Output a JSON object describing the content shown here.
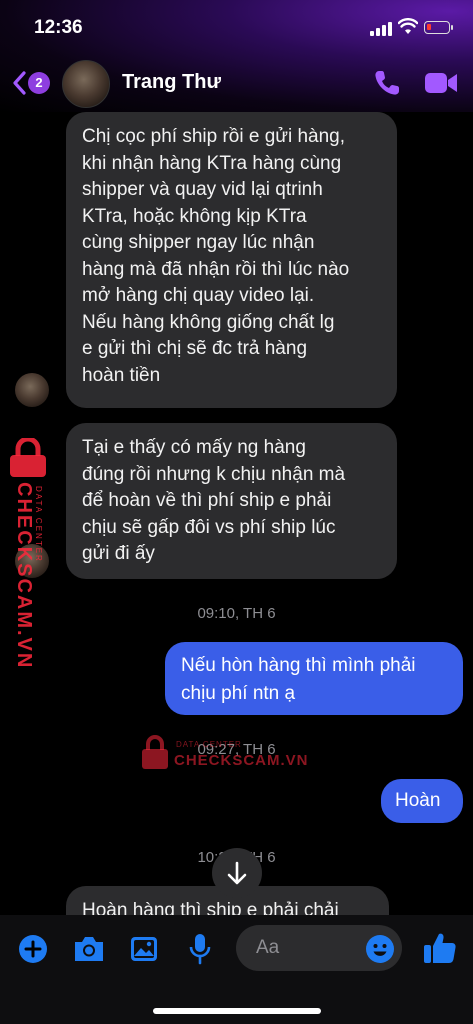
{
  "status_bar": {
    "time": "12:36"
  },
  "header": {
    "back_badge": "2",
    "contact_name": "Trang Thư"
  },
  "messages": {
    "m1": "Chị cọc phí ship rồi e gửi hàng,\nkhi nhận hàng KTra hàng cùng\nshipper và quay vid lại qtrinh\nKTra, hoặc không kịp KTra\ncùng shipper ngay lúc nhận\nhàng mà đã nhận rồi thì lúc nào\nmở hàng chị quay video lại.\nNếu hàng không giống chất lg\ne gửi thì chị sẽ đc trả hàng\nhoàn tiền",
    "m2": "Tại e thấy có mấy ng hàng\nđúng rồi nhưng k chịu nhận mà\nđể hoàn về thì phí ship e phải\nchịu sẽ gấp đôi vs phí ship lúc\ngửi đi ấy",
    "ts1": "09:10, TH 6",
    "m3": "Nếu hòn hàng thì mình phải\nchịu phí ntn ạ",
    "ts2": "09:27, TH 6",
    "m4": "Hoàn",
    "ts3": "10:29, TH 6",
    "m5": "Hoàn hàng thì ship e phải chải"
  },
  "watermark": {
    "brand": "CHECKSCAM.VN",
    "tagline": "DATA CENTER"
  },
  "composer": {
    "placeholder": "Aa"
  },
  "icons": [
    "back-icon",
    "phone-icon",
    "video-icon",
    "plus-icon",
    "camera-icon",
    "gallery-icon",
    "microphone-icon",
    "emoji-icon",
    "thumbs-up-icon",
    "scroll-down-icon",
    "lock-icon"
  ],
  "colors": {
    "accent": "#a259ff",
    "outgoing_bubble": "#3a5ee8",
    "incoming_bubble": "#2c2c2e",
    "composer_icon": "#1e7bf2",
    "watermark": "#ff2a3c"
  }
}
